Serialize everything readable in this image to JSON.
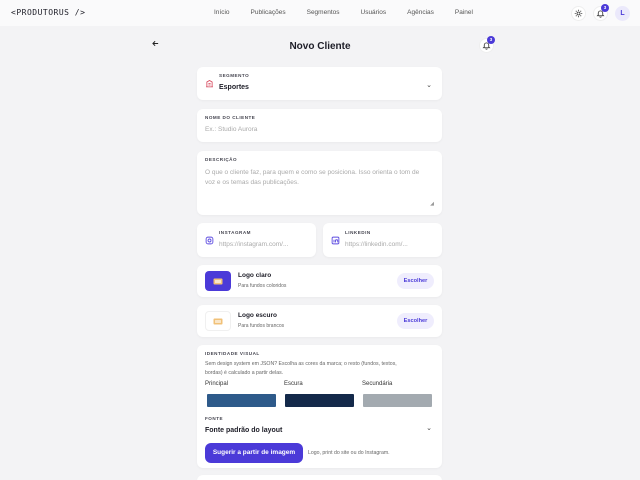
{
  "app": {
    "logo": "<PRODUTORUS />"
  },
  "nav": {
    "items": [
      "Início",
      "Publicações",
      "Segmentos",
      "Usuários",
      "Agências",
      "Painel"
    ]
  },
  "header": {
    "notif_count": "3",
    "avatar_letter": "L"
  },
  "page": {
    "title": "Novo Cliente",
    "notif_count": "3"
  },
  "segment": {
    "label": "SEGMENTO",
    "value": "Esportes"
  },
  "client_name": {
    "label": "NOME DO CLIENTE",
    "placeholder": "Ex.: Studio Aurora"
  },
  "description": {
    "label": "DESCRIÇÃO",
    "placeholder_line1": "O que o cliente faz, para quem e como se posiciona. Isso orienta o tom de",
    "placeholder_line2": "voz e os temas das publicações."
  },
  "instagram": {
    "label": "INSTAGRAM",
    "placeholder": "https://instagram.com/..."
  },
  "linkedin": {
    "label": "LINKEDIN",
    "placeholder": "https://linkedin.com/..."
  },
  "logo_light": {
    "title": "Logo claro",
    "subtitle": "Para fundos coloridos",
    "button": "Escolher"
  },
  "logo_dark": {
    "title": "Logo escuro",
    "subtitle": "Para fundos brancos",
    "button": "Escolher"
  },
  "identity": {
    "label": "IDENTIDADE VISUAL",
    "text_line1": "Sem design system em JSON? Escolha as cores da marca; o resto (fundos, textos,",
    "text_line2": "bordas) é calculado a partir delas.",
    "colors": [
      {
        "name": "Principal",
        "hex": "#2e5a8a"
      },
      {
        "name": "Escura",
        "hex": "#14294a"
      },
      {
        "name": "Secundária",
        "hex": "#a3aab0"
      }
    ]
  },
  "font": {
    "label": "FONTE",
    "value": "Fonte padrão do layout"
  },
  "suggest": {
    "button": "Sugerir a partir de imagem",
    "hint": "Logo, print do site ou do Instagram."
  },
  "colors": {
    "accent": "#4b3ad8",
    "logo_light_tile": "#4b3ad8",
    "logo_dark_tile": "#ffffff",
    "icon_red": "#d6455a",
    "icon_purple": "#5c4be0"
  }
}
